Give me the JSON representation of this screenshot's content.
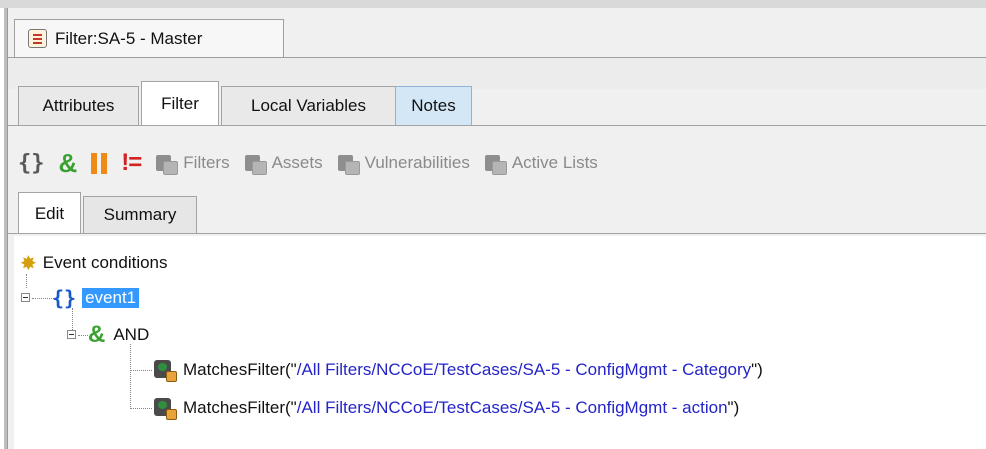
{
  "editor_tab": {
    "title": "Filter:SA-5 - Master"
  },
  "property_tabs": [
    {
      "label": "Attributes"
    },
    {
      "label": "Filter"
    },
    {
      "label": "Local Variables"
    },
    {
      "label": "Notes"
    }
  ],
  "toolbar": {
    "items": [
      {
        "icon": "braces-icon",
        "label": ""
      },
      {
        "icon": "and-icon",
        "label": ""
      },
      {
        "icon": "or-icon",
        "label": ""
      },
      {
        "icon": "not-icon",
        "label": ""
      },
      {
        "icon": "filters-icon",
        "label": "Filters"
      },
      {
        "icon": "assets-icon",
        "label": "Assets"
      },
      {
        "icon": "vulnerabilities-icon",
        "label": "Vulnerabilities"
      },
      {
        "icon": "active-lists-icon",
        "label": "Active Lists"
      }
    ]
  },
  "inner_tabs": [
    {
      "label": "Edit"
    },
    {
      "label": "Summary"
    }
  ],
  "tree": {
    "root": "Event conditions",
    "event": "event1",
    "op": "AND",
    "conditions": [
      {
        "func": "MatchesFilter(\"",
        "arg": "/All Filters/NCCoE/TestCases/SA-5 - ConfigMgmt - Category",
        "close": "\")"
      },
      {
        "func": "MatchesFilter(\"",
        "arg": "/All Filters/NCCoE/TestCases/SA-5 - ConfigMgmt - action",
        "close": "\")"
      }
    ]
  }
}
